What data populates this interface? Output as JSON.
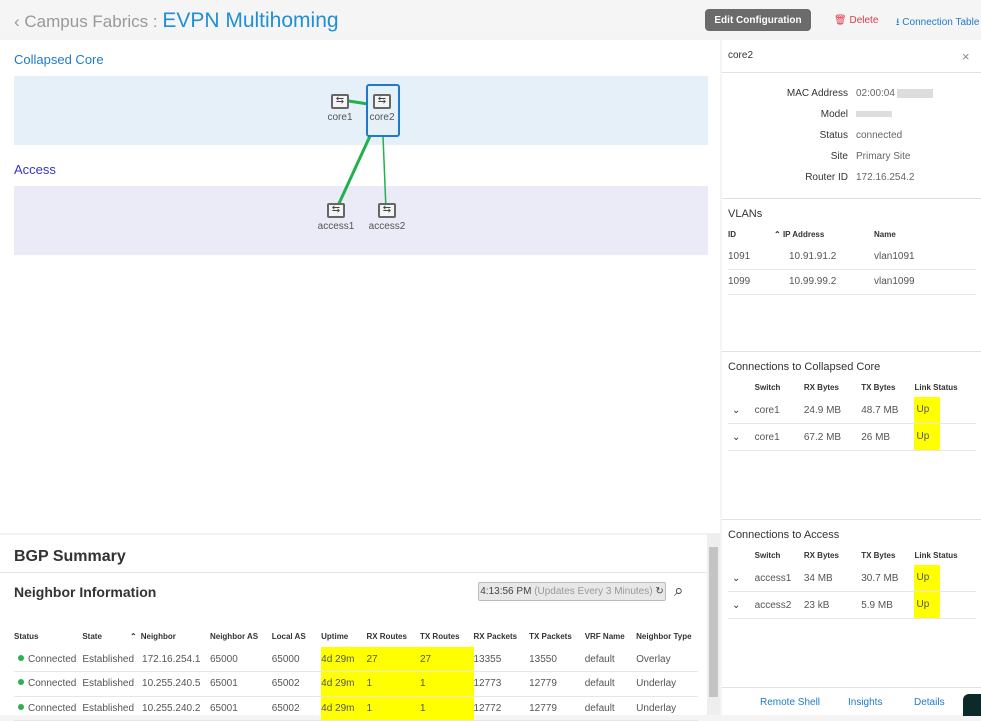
{
  "header": {
    "breadcrumb": "Campus Fabrics :",
    "title": "EVPN Multihoming",
    "edit": "Edit Configuration",
    "delete": "Delete",
    "connection_table": "Connection Table"
  },
  "topology": {
    "collapsed_core": "Collapsed Core",
    "access": "Access",
    "nodes": [
      "core1",
      "core2",
      "access1",
      "access2"
    ],
    "link_color": "#22b14c"
  },
  "bgp": {
    "title": "BGP Summary",
    "subtitle": "Neighbor Information",
    "time": "4:13:56 PM",
    "updates": "(Updates Every 3 Minutes)",
    "columns": [
      "Status",
      "State",
      "Neighbor",
      "Neighbor AS",
      "Local AS",
      "Uptime",
      "RX Routes",
      "TX Routes",
      "RX Packets",
      "TX Packets",
      "VRF Name",
      "Neighbor Type"
    ],
    "rows": [
      [
        "Connected",
        "Established",
        "172.16.254.1",
        "65000",
        "65000",
        "4d 29m",
        "27",
        "27",
        "13355",
        "13550",
        "default",
        "Overlay"
      ],
      [
        "Connected",
        "Established",
        "10.255.240.5",
        "65001",
        "65002",
        "4d 29m",
        "1",
        "1",
        "12773",
        "12779",
        "default",
        "Underlay"
      ],
      [
        "Connected",
        "Established",
        "10.255.240.2",
        "65001",
        "65002",
        "4d 29m",
        "1",
        "1",
        "12772",
        "12779",
        "default",
        "Underlay"
      ]
    ]
  },
  "panel": {
    "title": "core2",
    "props": [
      {
        "label": "MAC Address",
        "value": "02:00:04"
      },
      {
        "label": "Model",
        "value": ""
      },
      {
        "label": "Status",
        "value": "connected"
      },
      {
        "label": "Site",
        "value": "Primary Site"
      },
      {
        "label": "Router ID",
        "value": "172.16.254.2"
      }
    ],
    "vlans": {
      "title": "VLANs",
      "columns": [
        "ID",
        "IP Address",
        "Name"
      ],
      "rows": [
        [
          "1091",
          "10.91.91.2",
          "vlan1091"
        ],
        [
          "1099",
          "10.99.99.2",
          "vlan1099"
        ]
      ]
    },
    "core_conn": {
      "title": "Connections to Collapsed Core",
      "columns": [
        "Switch",
        "RX Bytes",
        "TX Bytes",
        "Link Status"
      ],
      "rows": [
        [
          "core1",
          "24.9 MB",
          "48.7 MB",
          "Up"
        ],
        [
          "core1",
          "67.2 MB",
          "26 MB",
          "Up"
        ]
      ]
    },
    "access_conn": {
      "title": "Connections to Access",
      "columns": [
        "Switch",
        "RX Bytes",
        "TX Bytes",
        "Link Status"
      ],
      "rows": [
        [
          "access1",
          "34 MB",
          "30.7 MB",
          "Up"
        ],
        [
          "access2",
          "23 kB",
          "5.9 MB",
          "Up"
        ]
      ]
    },
    "links": [
      "Remote Shell",
      "Insights",
      "Details"
    ]
  }
}
